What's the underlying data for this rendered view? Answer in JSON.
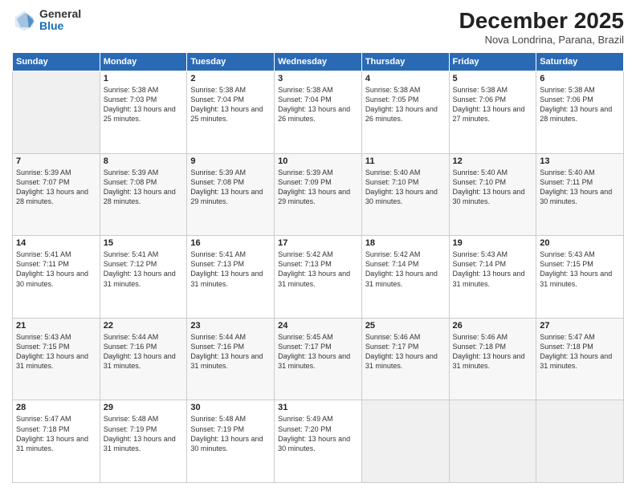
{
  "logo": {
    "general": "General",
    "blue": "Blue"
  },
  "header": {
    "title": "December 2025",
    "location": "Nova Londrina, Parana, Brazil"
  },
  "weekdays": [
    "Sunday",
    "Monday",
    "Tuesday",
    "Wednesday",
    "Thursday",
    "Friday",
    "Saturday"
  ],
  "weeks": [
    [
      {
        "day": "",
        "sunrise": "",
        "sunset": "",
        "daylight": ""
      },
      {
        "day": "1",
        "sunrise": "5:38 AM",
        "sunset": "7:03 PM",
        "daylight": "13 hours and 25 minutes."
      },
      {
        "day": "2",
        "sunrise": "5:38 AM",
        "sunset": "7:04 PM",
        "daylight": "13 hours and 25 minutes."
      },
      {
        "day": "3",
        "sunrise": "5:38 AM",
        "sunset": "7:04 PM",
        "daylight": "13 hours and 26 minutes."
      },
      {
        "day": "4",
        "sunrise": "5:38 AM",
        "sunset": "7:05 PM",
        "daylight": "13 hours and 26 minutes."
      },
      {
        "day": "5",
        "sunrise": "5:38 AM",
        "sunset": "7:06 PM",
        "daylight": "13 hours and 27 minutes."
      },
      {
        "day": "6",
        "sunrise": "5:38 AM",
        "sunset": "7:06 PM",
        "daylight": "13 hours and 28 minutes."
      }
    ],
    [
      {
        "day": "7",
        "sunrise": "5:39 AM",
        "sunset": "7:07 PM",
        "daylight": "13 hours and 28 minutes."
      },
      {
        "day": "8",
        "sunrise": "5:39 AM",
        "sunset": "7:08 PM",
        "daylight": "13 hours and 28 minutes."
      },
      {
        "day": "9",
        "sunrise": "5:39 AM",
        "sunset": "7:08 PM",
        "daylight": "13 hours and 29 minutes."
      },
      {
        "day": "10",
        "sunrise": "5:39 AM",
        "sunset": "7:09 PM",
        "daylight": "13 hours and 29 minutes."
      },
      {
        "day": "11",
        "sunrise": "5:40 AM",
        "sunset": "7:10 PM",
        "daylight": "13 hours and 30 minutes."
      },
      {
        "day": "12",
        "sunrise": "5:40 AM",
        "sunset": "7:10 PM",
        "daylight": "13 hours and 30 minutes."
      },
      {
        "day": "13",
        "sunrise": "5:40 AM",
        "sunset": "7:11 PM",
        "daylight": "13 hours and 30 minutes."
      }
    ],
    [
      {
        "day": "14",
        "sunrise": "5:41 AM",
        "sunset": "7:11 PM",
        "daylight": "13 hours and 30 minutes."
      },
      {
        "day": "15",
        "sunrise": "5:41 AM",
        "sunset": "7:12 PM",
        "daylight": "13 hours and 31 minutes."
      },
      {
        "day": "16",
        "sunrise": "5:41 AM",
        "sunset": "7:13 PM",
        "daylight": "13 hours and 31 minutes."
      },
      {
        "day": "17",
        "sunrise": "5:42 AM",
        "sunset": "7:13 PM",
        "daylight": "13 hours and 31 minutes."
      },
      {
        "day": "18",
        "sunrise": "5:42 AM",
        "sunset": "7:14 PM",
        "daylight": "13 hours and 31 minutes."
      },
      {
        "day": "19",
        "sunrise": "5:43 AM",
        "sunset": "7:14 PM",
        "daylight": "13 hours and 31 minutes."
      },
      {
        "day": "20",
        "sunrise": "5:43 AM",
        "sunset": "7:15 PM",
        "daylight": "13 hours and 31 minutes."
      }
    ],
    [
      {
        "day": "21",
        "sunrise": "5:43 AM",
        "sunset": "7:15 PM",
        "daylight": "13 hours and 31 minutes."
      },
      {
        "day": "22",
        "sunrise": "5:44 AM",
        "sunset": "7:16 PM",
        "daylight": "13 hours and 31 minutes."
      },
      {
        "day": "23",
        "sunrise": "5:44 AM",
        "sunset": "7:16 PM",
        "daylight": "13 hours and 31 minutes."
      },
      {
        "day": "24",
        "sunrise": "5:45 AM",
        "sunset": "7:17 PM",
        "daylight": "13 hours and 31 minutes."
      },
      {
        "day": "25",
        "sunrise": "5:46 AM",
        "sunset": "7:17 PM",
        "daylight": "13 hours and 31 minutes."
      },
      {
        "day": "26",
        "sunrise": "5:46 AM",
        "sunset": "7:18 PM",
        "daylight": "13 hours and 31 minutes."
      },
      {
        "day": "27",
        "sunrise": "5:47 AM",
        "sunset": "7:18 PM",
        "daylight": "13 hours and 31 minutes."
      }
    ],
    [
      {
        "day": "28",
        "sunrise": "5:47 AM",
        "sunset": "7:18 PM",
        "daylight": "13 hours and 31 minutes."
      },
      {
        "day": "29",
        "sunrise": "5:48 AM",
        "sunset": "7:19 PM",
        "daylight": "13 hours and 31 minutes."
      },
      {
        "day": "30",
        "sunrise": "5:48 AM",
        "sunset": "7:19 PM",
        "daylight": "13 hours and 30 minutes."
      },
      {
        "day": "31",
        "sunrise": "5:49 AM",
        "sunset": "7:20 PM",
        "daylight": "13 hours and 30 minutes."
      },
      {
        "day": "",
        "sunrise": "",
        "sunset": "",
        "daylight": ""
      },
      {
        "day": "",
        "sunrise": "",
        "sunset": "",
        "daylight": ""
      },
      {
        "day": "",
        "sunrise": "",
        "sunset": "",
        "daylight": ""
      }
    ]
  ]
}
